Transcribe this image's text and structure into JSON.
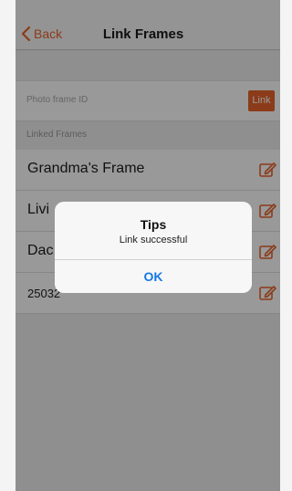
{
  "nav": {
    "back_label": "Back",
    "title": "Link Frames"
  },
  "link_section": {
    "id_placeholder": "Photo frame ID",
    "link_button": "Link"
  },
  "linked": {
    "header": "Linked Frames",
    "frames": [
      {
        "name": "Grandma's Frame"
      },
      {
        "name": "Livi"
      },
      {
        "name": "Dac"
      },
      {
        "name": "25032"
      }
    ]
  },
  "alert": {
    "title": "Tips",
    "message": "Link successful",
    "ok_label": "OK"
  },
  "colors": {
    "accent": "#e8632a",
    "alert_button": "#1677e5"
  }
}
